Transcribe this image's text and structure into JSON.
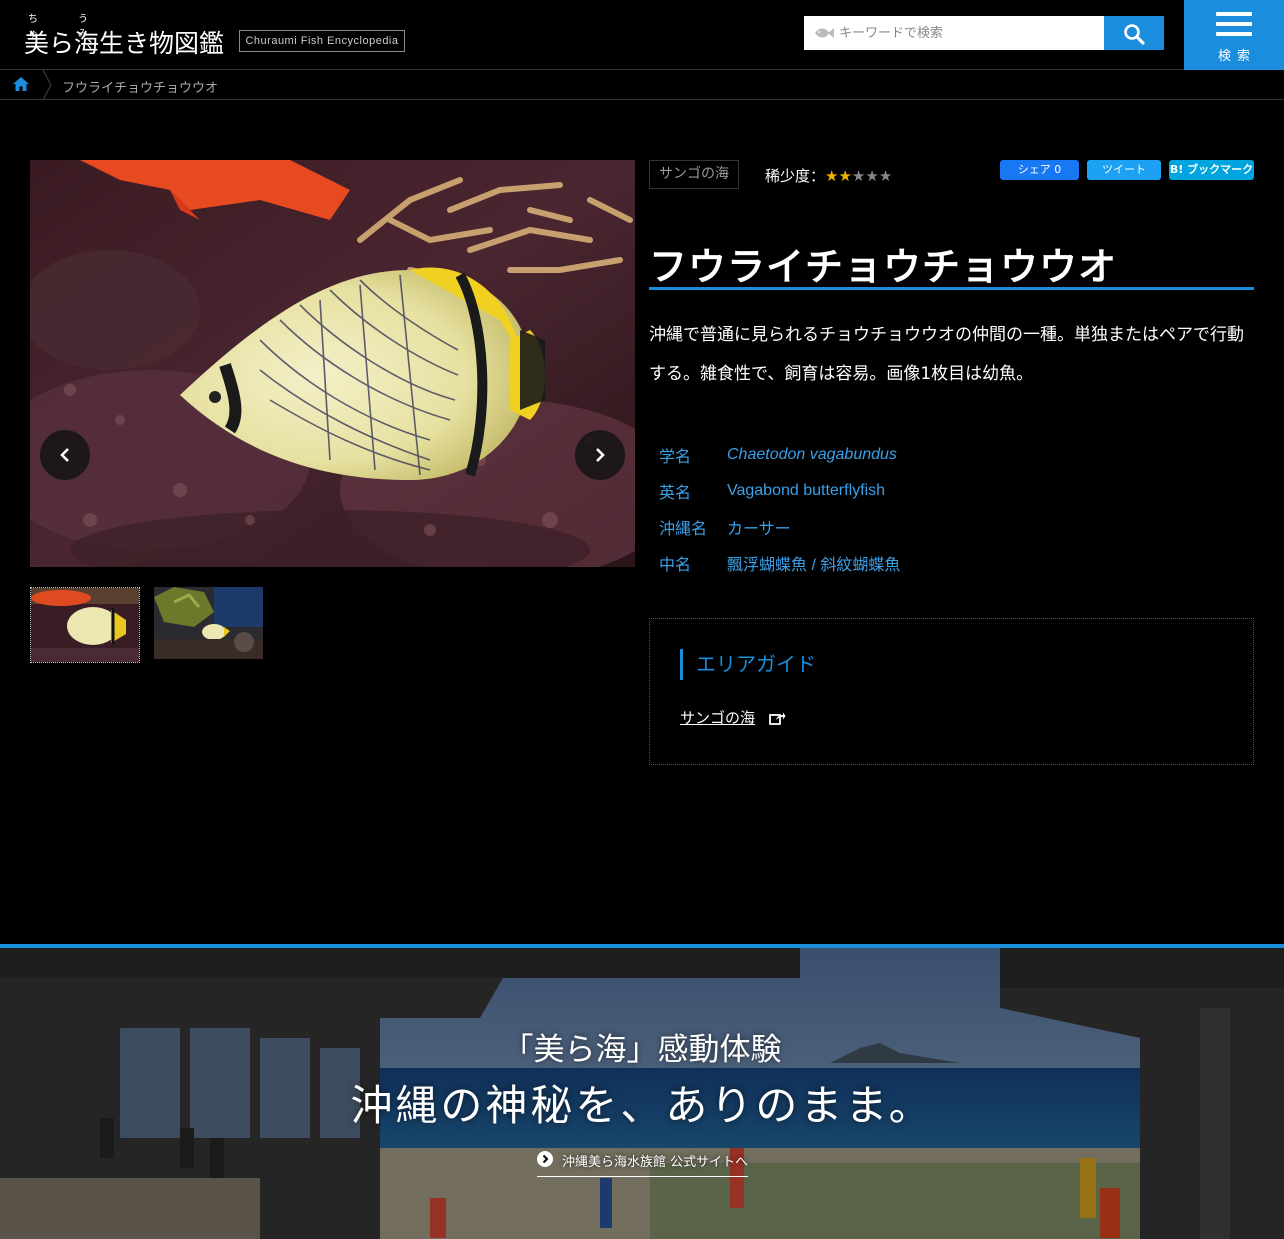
{
  "header": {
    "logo_ruby_1": "ちゅ",
    "logo_ruby_2": "うみ",
    "logo_title": "美ら海生き物図鑑",
    "logo_subtitle": "Churaumi Fish Encyclopedia",
    "search_placeholder": "キーワードで検索",
    "search_icon": "search-icon",
    "menu_label": "検索",
    "menu_icon": "hamburger-icon"
  },
  "breadcrumb": {
    "home_icon": "home-icon",
    "current": "フウライチョウチョウウオ"
  },
  "gallery": {
    "image_count": 2,
    "active_index": 1
  },
  "species": {
    "area_tag": "サンゴの海",
    "rarity_label": "稀少度：",
    "rarity_value": 2,
    "rarity_max": 5,
    "rarity_stars_filled": "★★",
    "rarity_stars_empty": "★★★",
    "title": "フウライチョウチョウウオ",
    "description": "沖縄で普通に見られるチョウチョウウオの仲間の一種。単独またはペアで行動する。雑食性で、飼育は容易。画像1枚目は幼魚。",
    "info": [
      {
        "key": "学名",
        "value": "Chaetodon vagabundus"
      },
      {
        "key": "英名",
        "value": "Vagabond butterflyfish"
      },
      {
        "key": "沖縄名",
        "value": "カーサー"
      },
      {
        "key": "中名",
        "value": "飄浮蝴蝶魚 / 斜紋蝴蝶魚"
      }
    ]
  },
  "share": {
    "facebook": "シェア 0",
    "twitter": "ツイート",
    "hatena": "B! ブックマーク"
  },
  "area_guide": {
    "heading": "エリアガイド",
    "link": "サンゴの海"
  },
  "banner": {
    "subtitle": "「美ら海」感動体験",
    "title": "沖縄の神秘を、ありのまま。",
    "link": "沖縄美ら海水族館 公式サイトへ"
  },
  "colors": {
    "accent": "#1a8ddd",
    "star_filled": "#f2b300",
    "star_empty": "#888888",
    "info_text": "#3aa0e8"
  }
}
